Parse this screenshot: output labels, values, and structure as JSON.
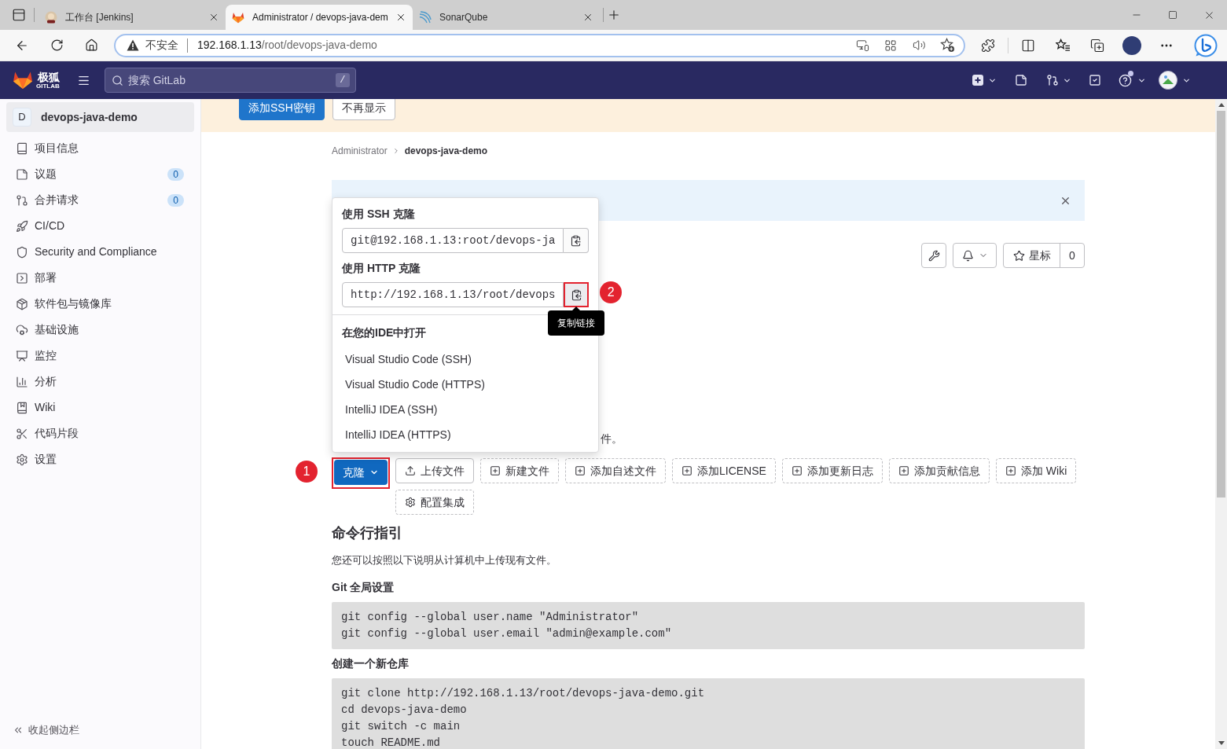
{
  "browser": {
    "tabs": [
      {
        "title": "工作台 [Jenkins]",
        "selected": false
      },
      {
        "title": "Administrator / devops-java-dem",
        "selected": true
      },
      {
        "title": "SonarQube",
        "selected": false
      }
    ],
    "address": {
      "security_label": "不安全",
      "host": "192.168.1.13",
      "path": "/root/devops-java-demo"
    }
  },
  "header": {
    "logo": {
      "name": "极狐",
      "subname": "GITLAB"
    },
    "search": {
      "placeholder": "搜索 GitLab",
      "shortcut": "/"
    }
  },
  "sidebar": {
    "project": {
      "avatar": "D",
      "name": "devops-java-demo"
    },
    "items": [
      {
        "label": "项目信息"
      },
      {
        "label": "议题",
        "count": "0"
      },
      {
        "label": "合并请求",
        "count": "0"
      },
      {
        "label": "CI/CD"
      },
      {
        "label": "Security and Compliance"
      },
      {
        "label": "部署"
      },
      {
        "label": "软件包与镜像库"
      },
      {
        "label": "基础设施"
      },
      {
        "label": "监控"
      },
      {
        "label": "分析"
      },
      {
        "label": "Wiki"
      },
      {
        "label": "代码片段"
      },
      {
        "label": "设置"
      }
    ],
    "collapse_label": "收起侧边栏"
  },
  "banner": {
    "buttons": [
      {
        "label": "添加SSH密钥",
        "kind": "primary"
      },
      {
        "label": "不再显示",
        "kind": "default"
      }
    ]
  },
  "breadcrumb": [
    "Administrator",
    "devops-java-demo"
  ],
  "project_actions": {
    "star_label": "星标",
    "star_count": "0"
  },
  "clone_dropdown": {
    "sections": [
      {
        "title": "使用 SSH 克隆",
        "url": "git@192.168.1.13:root/devops-ja"
      },
      {
        "title": "使用 HTTP 克隆",
        "url": "http://192.168.1.13/root/devops",
        "annotation": "2",
        "tooltip": "复制链接"
      }
    ],
    "ide_title": "在您的IDE中打开",
    "ide_items": [
      "Visual Studio Code (SSH)",
      "Visual Studio Code (HTTPS)",
      "IntelliJ IDEA (SSH)",
      "IntelliJ IDEA (HTTPS)"
    ]
  },
  "covered_text": "件。",
  "actions": {
    "clone": {
      "label": "克隆",
      "annotation": "1"
    },
    "buttons": [
      {
        "label": "上传文件",
        "kind": "upload"
      },
      {
        "label": "新建文件",
        "kind": "add"
      },
      {
        "label": "添加自述文件",
        "kind": "add"
      },
      {
        "label": "添加LICENSE",
        "kind": "add"
      },
      {
        "label": "添加更新日志",
        "kind": "add"
      },
      {
        "label": "添加贡献信息",
        "kind": "add"
      },
      {
        "label": "添加 Wiki",
        "kind": "add"
      },
      {
        "label": "配置集成",
        "kind": "settings"
      }
    ]
  },
  "cli": {
    "title": "命令行指引",
    "intro": "您还可以按照以下说明从计算机中上传现有文件。",
    "sections": [
      {
        "title": "Git 全局设置",
        "code": [
          "git config --global user.name \"Administrator\"",
          "git config --global user.email \"admin@example.com\""
        ]
      },
      {
        "title": "创建一个新仓库",
        "code": [
          "git clone http://192.168.1.13/root/devops-java-demo.git",
          "cd devops-java-demo",
          "git switch -c main",
          "touch README.md"
        ]
      }
    ]
  }
}
